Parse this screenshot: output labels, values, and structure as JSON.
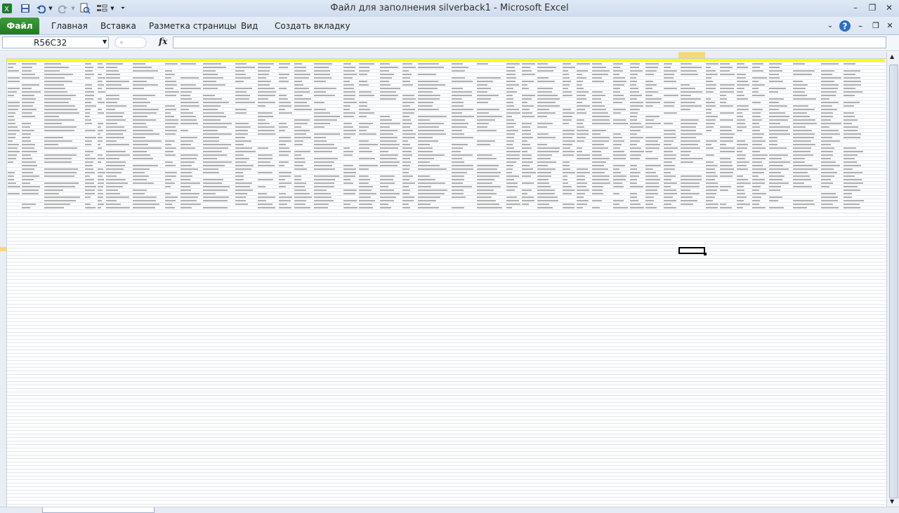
{
  "window": {
    "title": "Файл для заполнения silverback1  -  Microsoft Excel",
    "controls": {
      "minimize": "–",
      "restore": "❐",
      "close": "✕"
    }
  },
  "ribbon": {
    "file_tab": "Файл",
    "tabs": [
      "Главная",
      "Вставка",
      "Разметка страницы",
      "Вид",
      "Создать вкладку"
    ]
  },
  "formula_bar": {
    "name_box": "R56C32",
    "fx": "fx",
    "formula": ""
  },
  "sheet": {
    "selected_cell": "R56C32",
    "header_fill": "#ffff00"
  },
  "colors": {
    "file_tab": "#2e8b2a",
    "header_row": "#ffff00"
  }
}
